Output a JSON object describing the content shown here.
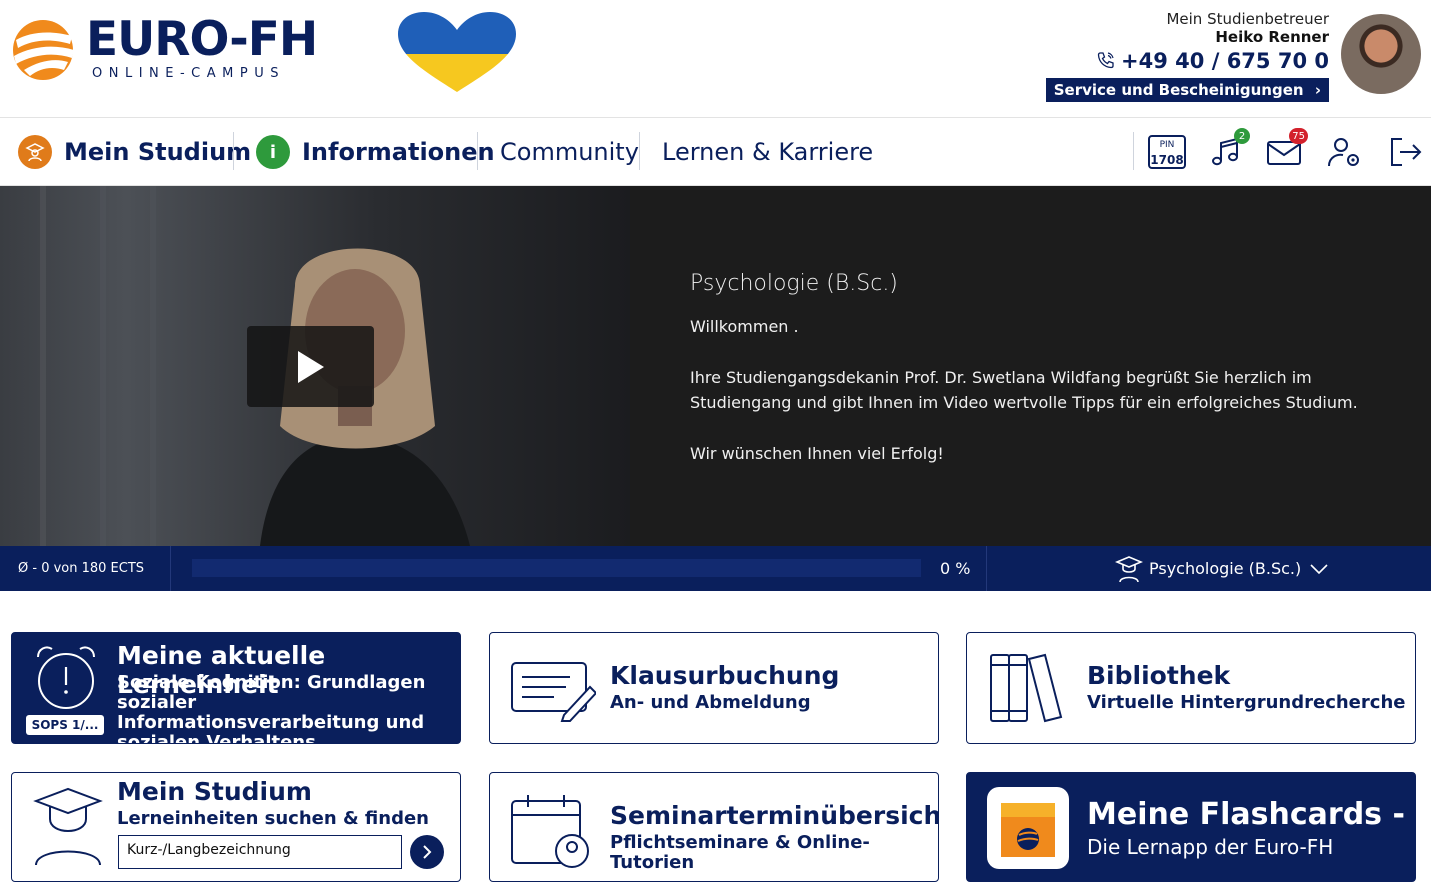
{
  "header": {
    "logo_name": "EURO-FH",
    "logo_sub": "ONLINE-CAMPUS",
    "advisor_role": "Mein Studienbetreuer",
    "advisor_name": "Heiko Renner",
    "phone": "+49 40 / 675 70 0",
    "service_button": "Service und Bescheinigungen"
  },
  "nav": {
    "items": [
      {
        "label": "Mein Studium",
        "icon": "student-icon",
        "color": "#e07b1a"
      },
      {
        "label": "Informationen",
        "icon": "info-icon",
        "color": "#2e9a3c"
      },
      {
        "label": "Community"
      },
      {
        "label": "Lernen & Karriere"
      }
    ],
    "pin_label": "PIN",
    "pin_value": "1708",
    "notifications_count": "2",
    "messages_count": "75"
  },
  "hero": {
    "title": "Psychologie (B.Sc.)",
    "greeting": "Willkommen .",
    "body": "Ihre Studiengangsdekanin Prof. Dr. Swetlana Wildfang begrüßt Sie herzlich im Studiengang und gibt Ihnen im Video wertvolle Tipps für ein erfolgreiches Studium.",
    "closing": "Wir wünschen Ihnen viel Erfolg!"
  },
  "progress": {
    "ects_text": "Ø - 0 von 180 ECTS",
    "percent_text": "0 %",
    "percent_value": 0,
    "course": "Psychologie (B.Sc.)"
  },
  "tiles": {
    "current_unit": {
      "title": "Meine aktuelle Lerneinheit",
      "subtitle": "Soziale Kognition: Grundlagen sozialer Informationsverarbeitung und sozialen Verhaltens",
      "badge": "SOPS 1/..."
    },
    "exam_booking": {
      "title": "Klausurbuchung",
      "subtitle": "An- und Abmeldung"
    },
    "library": {
      "title": "Bibliothek",
      "subtitle": "Virtuelle Hintergrundrecherche"
    },
    "my_studies": {
      "title": "Mein Studium",
      "subtitle": "Lerneinheiten suchen & finden",
      "input_value": "Kurz-/Langbezeichnung"
    },
    "seminars": {
      "title": "Seminarterminübersicht",
      "subtitle": "Pflichtseminare & Online-Tutorien"
    },
    "flashcards": {
      "title": "Meine Flashcards -",
      "subtitle": "Die Lernapp der Euro-FH"
    }
  },
  "colors": {
    "brand": "#0a1f5c",
    "accent": "#f08a1c",
    "badge_green": "#2e9a3c",
    "badge_red": "#d3212c"
  }
}
